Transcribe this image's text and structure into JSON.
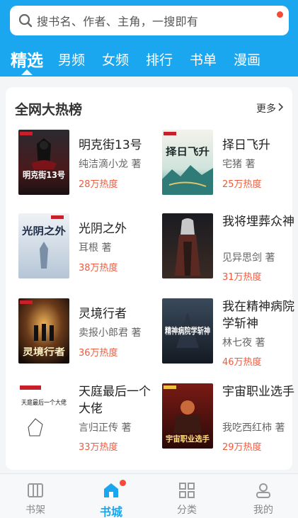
{
  "search": {
    "placeholder": "搜书名、作者、主角，一搜即有"
  },
  "tabs": [
    {
      "label": "精选",
      "active": true
    },
    {
      "label": "男频"
    },
    {
      "label": "女频"
    },
    {
      "label": "排行"
    },
    {
      "label": "书单"
    },
    {
      "label": "漫画"
    }
  ],
  "section": {
    "title": "全网大热榜",
    "more_label": "更多"
  },
  "books": [
    {
      "title": "明克街13号",
      "author": "纯洁滴小龙 著",
      "heat": "28万热度",
      "cover_text": "明克街13号"
    },
    {
      "title": "择日飞升",
      "author": "宅猪 著",
      "heat": "25万热度",
      "cover_text": "择日飞升"
    },
    {
      "title": "光阴之外",
      "author": "耳根  著",
      "heat": "38万热度",
      "cover_text": "光阴之外"
    },
    {
      "title": "我将埋葬众神",
      "author": "见异思剑 著",
      "heat": "31万热度",
      "cover_text": ""
    },
    {
      "title": "灵境行者",
      "author": "卖报小郎君 著",
      "heat": "36万热度",
      "cover_text": "灵境行者"
    },
    {
      "title": "我在精神病院学斩神",
      "author": "林七夜 著",
      "heat": "46万热度",
      "cover_text": "精神病院学斩神"
    },
    {
      "title": "天庭最后一个大佬",
      "author": "言归正传 著",
      "heat": "33万热度",
      "cover_text": "天庭最后一个大佬"
    },
    {
      "title": "宇宙职业选手",
      "author": "我吃西红柿 著",
      "heat": "29万热度",
      "cover_text": "宇宙职业选手"
    }
  ],
  "bottom_nav": [
    {
      "label": "书架",
      "icon": "bookshelf-icon"
    },
    {
      "label": "书城",
      "icon": "home-icon",
      "active": true
    },
    {
      "label": "分类",
      "icon": "category-grid-icon"
    },
    {
      "label": "我的",
      "icon": "profile-icon"
    }
  ],
  "colors": {
    "brand": "#1aa7f0",
    "heat": "#f05a3c",
    "badge": "#f44a36"
  }
}
